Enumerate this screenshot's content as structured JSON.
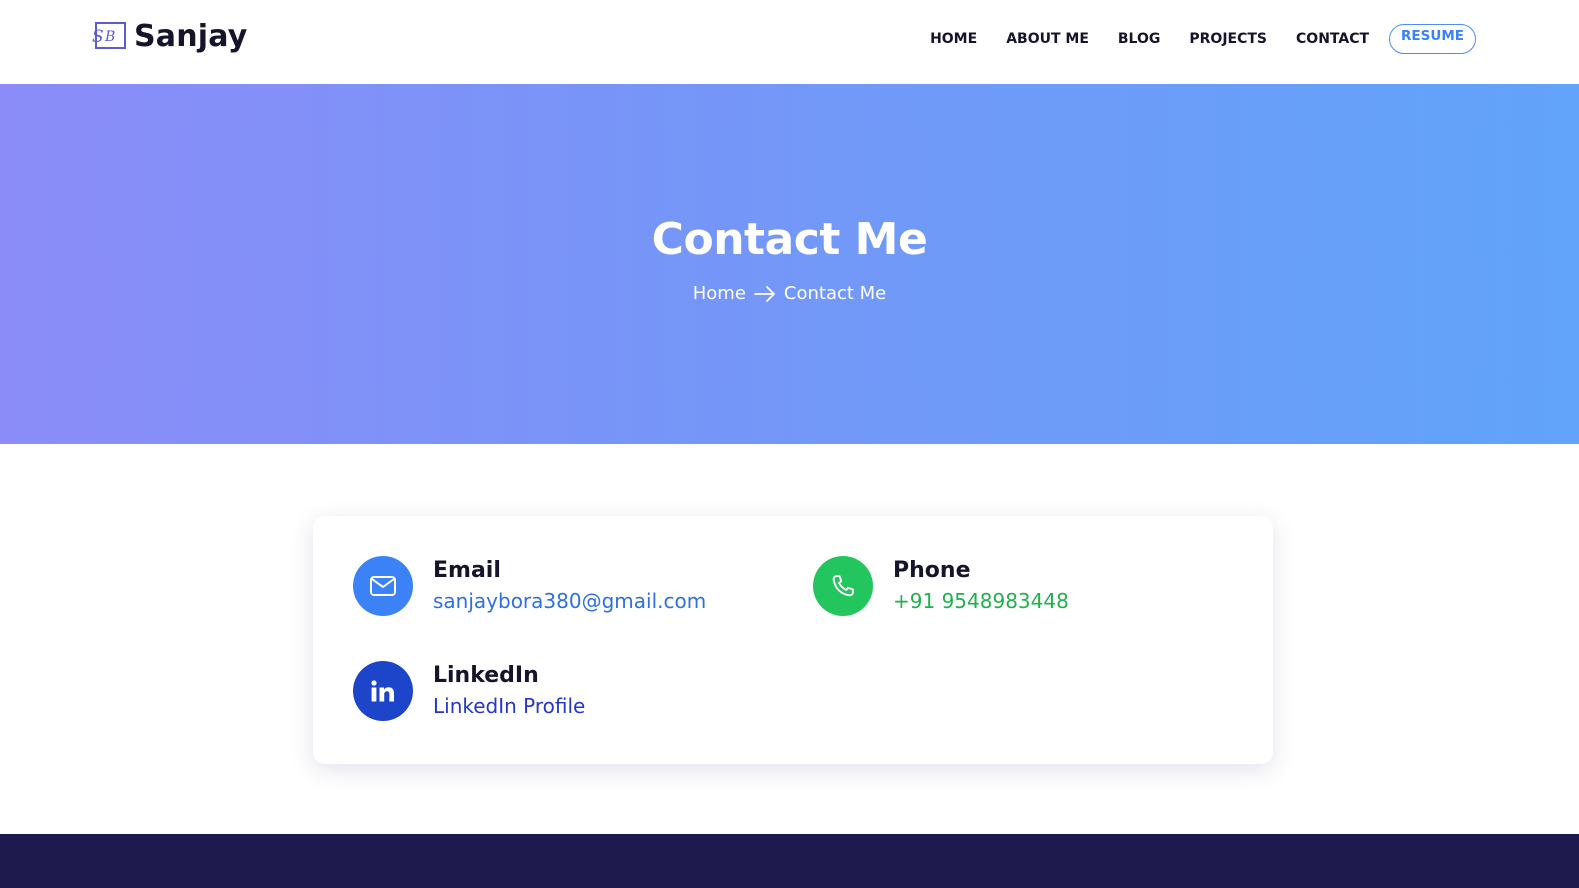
{
  "brand": {
    "name": "Sanjay",
    "logo_icon": "sb-monogram-icon",
    "accent_color": "#5b5bd6"
  },
  "nav": {
    "items": [
      {
        "label": "HOME"
      },
      {
        "label": "ABOUT ME"
      },
      {
        "label": "BLOG"
      },
      {
        "label": "PROJECTS"
      },
      {
        "label": "CONTACT"
      }
    ],
    "resume_label": "RESUME"
  },
  "hero": {
    "title": "Contact Me",
    "breadcrumb": {
      "home": "Home",
      "separator_icon": "arrow-right-icon",
      "current": "Contact Me"
    },
    "gradient_start": "#8b8cf8",
    "gradient_end": "#61a4f9"
  },
  "contact": {
    "email": {
      "label": "Email",
      "value": "sanjaybora380@gmail.com",
      "icon": "mail-icon",
      "color": "#3b82f6"
    },
    "phone": {
      "label": "Phone",
      "value": "+91 9548983448",
      "icon": "phone-icon",
      "color": "#22c55e"
    },
    "linkedin": {
      "label": "LinkedIn",
      "value": "LinkedIn Profile",
      "icon": "linkedin-icon",
      "color": "#1d45c9"
    }
  },
  "footer": {
    "background": "#1e1a4d"
  }
}
